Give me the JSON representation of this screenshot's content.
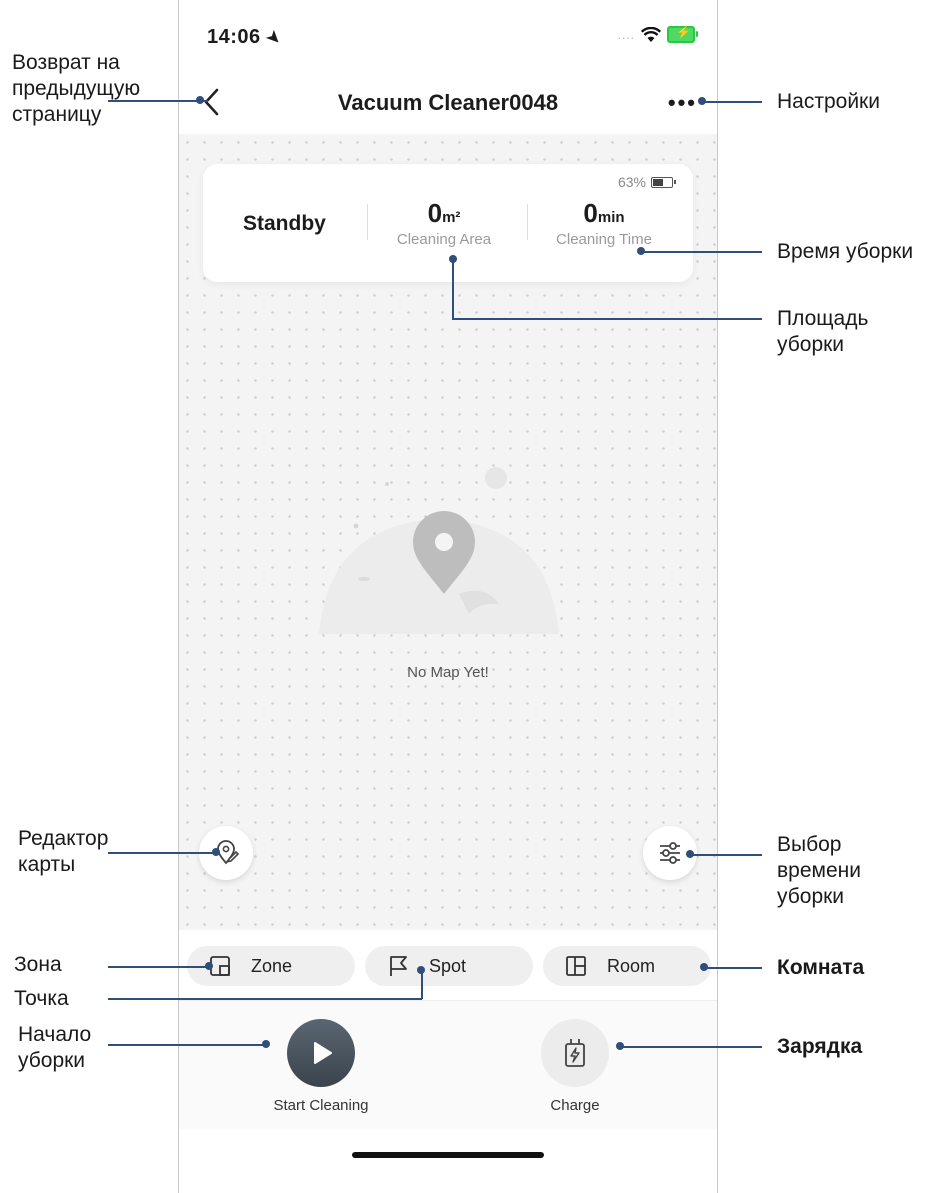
{
  "status_bar": {
    "time": "14:06",
    "signal": "....",
    "battery_colors": {
      "fill": "#4cd964"
    }
  },
  "nav": {
    "title": "Vacuum Cleaner0048",
    "more": "•••"
  },
  "stats": {
    "battery_percent": "63%",
    "status": "Standby",
    "area_value": "0",
    "area_unit": "m²",
    "area_label": "Cleaning Area",
    "time_value": "0",
    "time_unit": "min",
    "time_label": "Cleaning Time"
  },
  "map": {
    "empty_text": "No Map Yet!"
  },
  "modes": [
    {
      "label": "Zone",
      "icon": "zone-icon"
    },
    {
      "label": "Spot",
      "icon": "flag-icon"
    },
    {
      "label": "Room",
      "icon": "room-icon"
    }
  ],
  "actions": {
    "start_label": "Start Cleaning",
    "charge_label": "Charge"
  },
  "annotations": {
    "back": "Возврат на предыдущую страницу",
    "settings": "Настройки",
    "cleaning_time": "Время уборки",
    "cleaning_area": "Площадь уборки",
    "map_editor": "Редактор карты",
    "schedule": "Выбор времени уборки",
    "zone": "Зона",
    "spot": "Точка",
    "room": "Комната",
    "start": "Начало уборки",
    "charge": "Зарядка"
  },
  "colors": {
    "leader": "#2f4e7a",
    "start_button": "#4a545e",
    "map_bg": "#f4f4f4"
  }
}
